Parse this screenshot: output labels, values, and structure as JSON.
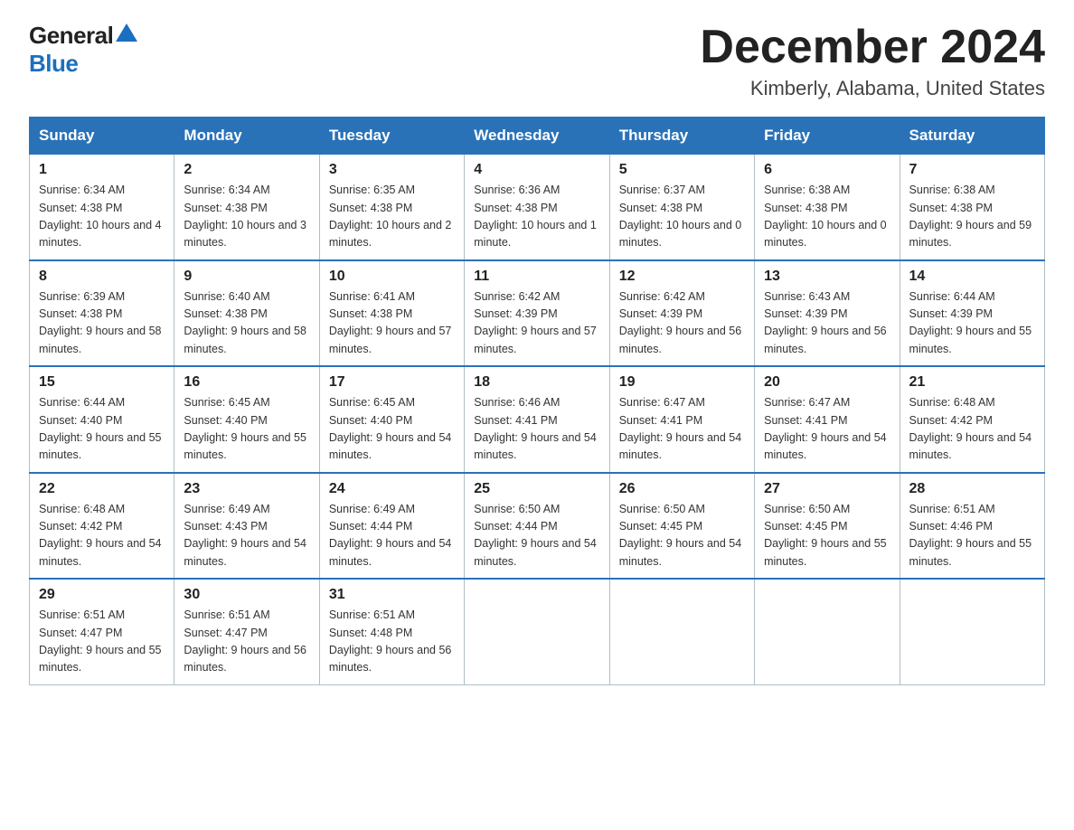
{
  "logo": {
    "general": "General",
    "blue": "Blue"
  },
  "header": {
    "title": "December 2024",
    "subtitle": "Kimberly, Alabama, United States"
  },
  "weekdays": [
    "Sunday",
    "Monday",
    "Tuesday",
    "Wednesday",
    "Thursday",
    "Friday",
    "Saturday"
  ],
  "weeks": [
    [
      {
        "day": "1",
        "sunrise": "6:34 AM",
        "sunset": "4:38 PM",
        "daylight": "10 hours and 4 minutes."
      },
      {
        "day": "2",
        "sunrise": "6:34 AM",
        "sunset": "4:38 PM",
        "daylight": "10 hours and 3 minutes."
      },
      {
        "day": "3",
        "sunrise": "6:35 AM",
        "sunset": "4:38 PM",
        "daylight": "10 hours and 2 minutes."
      },
      {
        "day": "4",
        "sunrise": "6:36 AM",
        "sunset": "4:38 PM",
        "daylight": "10 hours and 1 minute."
      },
      {
        "day": "5",
        "sunrise": "6:37 AM",
        "sunset": "4:38 PM",
        "daylight": "10 hours and 0 minutes."
      },
      {
        "day": "6",
        "sunrise": "6:38 AM",
        "sunset": "4:38 PM",
        "daylight": "10 hours and 0 minutes."
      },
      {
        "day": "7",
        "sunrise": "6:38 AM",
        "sunset": "4:38 PM",
        "daylight": "9 hours and 59 minutes."
      }
    ],
    [
      {
        "day": "8",
        "sunrise": "6:39 AM",
        "sunset": "4:38 PM",
        "daylight": "9 hours and 58 minutes."
      },
      {
        "day": "9",
        "sunrise": "6:40 AM",
        "sunset": "4:38 PM",
        "daylight": "9 hours and 58 minutes."
      },
      {
        "day": "10",
        "sunrise": "6:41 AM",
        "sunset": "4:38 PM",
        "daylight": "9 hours and 57 minutes."
      },
      {
        "day": "11",
        "sunrise": "6:42 AM",
        "sunset": "4:39 PM",
        "daylight": "9 hours and 57 minutes."
      },
      {
        "day": "12",
        "sunrise": "6:42 AM",
        "sunset": "4:39 PM",
        "daylight": "9 hours and 56 minutes."
      },
      {
        "day": "13",
        "sunrise": "6:43 AM",
        "sunset": "4:39 PM",
        "daylight": "9 hours and 56 minutes."
      },
      {
        "day": "14",
        "sunrise": "6:44 AM",
        "sunset": "4:39 PM",
        "daylight": "9 hours and 55 minutes."
      }
    ],
    [
      {
        "day": "15",
        "sunrise": "6:44 AM",
        "sunset": "4:40 PM",
        "daylight": "9 hours and 55 minutes."
      },
      {
        "day": "16",
        "sunrise": "6:45 AM",
        "sunset": "4:40 PM",
        "daylight": "9 hours and 55 minutes."
      },
      {
        "day": "17",
        "sunrise": "6:45 AM",
        "sunset": "4:40 PM",
        "daylight": "9 hours and 54 minutes."
      },
      {
        "day": "18",
        "sunrise": "6:46 AM",
        "sunset": "4:41 PM",
        "daylight": "9 hours and 54 minutes."
      },
      {
        "day": "19",
        "sunrise": "6:47 AM",
        "sunset": "4:41 PM",
        "daylight": "9 hours and 54 minutes."
      },
      {
        "day": "20",
        "sunrise": "6:47 AM",
        "sunset": "4:41 PM",
        "daylight": "9 hours and 54 minutes."
      },
      {
        "day": "21",
        "sunrise": "6:48 AM",
        "sunset": "4:42 PM",
        "daylight": "9 hours and 54 minutes."
      }
    ],
    [
      {
        "day": "22",
        "sunrise": "6:48 AM",
        "sunset": "4:42 PM",
        "daylight": "9 hours and 54 minutes."
      },
      {
        "day": "23",
        "sunrise": "6:49 AM",
        "sunset": "4:43 PM",
        "daylight": "9 hours and 54 minutes."
      },
      {
        "day": "24",
        "sunrise": "6:49 AM",
        "sunset": "4:44 PM",
        "daylight": "9 hours and 54 minutes."
      },
      {
        "day": "25",
        "sunrise": "6:50 AM",
        "sunset": "4:44 PM",
        "daylight": "9 hours and 54 minutes."
      },
      {
        "day": "26",
        "sunrise": "6:50 AM",
        "sunset": "4:45 PM",
        "daylight": "9 hours and 54 minutes."
      },
      {
        "day": "27",
        "sunrise": "6:50 AM",
        "sunset": "4:45 PM",
        "daylight": "9 hours and 55 minutes."
      },
      {
        "day": "28",
        "sunrise": "6:51 AM",
        "sunset": "4:46 PM",
        "daylight": "9 hours and 55 minutes."
      }
    ],
    [
      {
        "day": "29",
        "sunrise": "6:51 AM",
        "sunset": "4:47 PM",
        "daylight": "9 hours and 55 minutes."
      },
      {
        "day": "30",
        "sunrise": "6:51 AM",
        "sunset": "4:47 PM",
        "daylight": "9 hours and 56 minutes."
      },
      {
        "day": "31",
        "sunrise": "6:51 AM",
        "sunset": "4:48 PM",
        "daylight": "9 hours and 56 minutes."
      },
      null,
      null,
      null,
      null
    ]
  ]
}
